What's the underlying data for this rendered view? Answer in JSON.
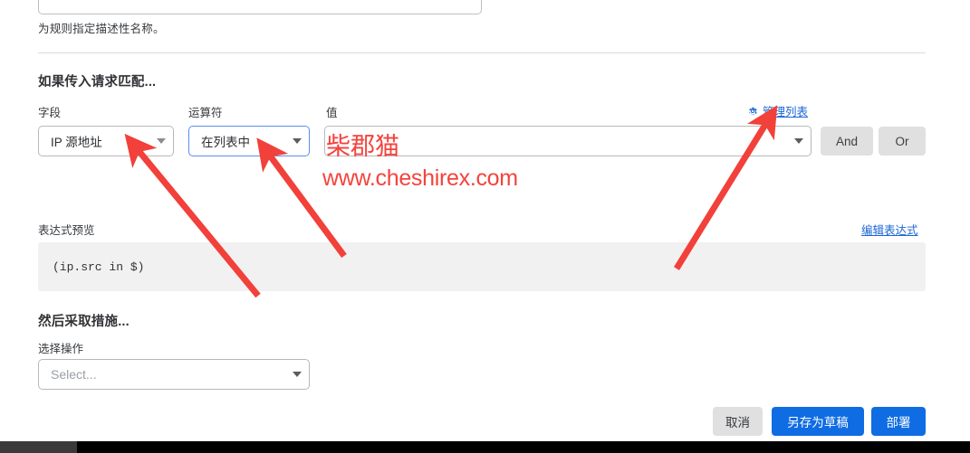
{
  "form": {
    "rule_name_value": "",
    "helper_text": "为规则指定描述性名称。",
    "match_section_heading": "如果传入请求匹配...",
    "action_section_heading": "然后采取措施...",
    "labels": {
      "field": "字段",
      "operator": "运算符",
      "value": "值",
      "select_action": "选择操作",
      "expression_preview": "表达式预览"
    },
    "selects": {
      "field_value": "IP 源地址",
      "operator_value": "在列表中",
      "value_value": "",
      "action_placeholder": "Select..."
    },
    "logic": {
      "and_label": "And",
      "or_label": "Or"
    },
    "links": {
      "manage_list": "管理列表",
      "edit_expression": "编辑表达式"
    },
    "expression": "(ip.src in $)",
    "buttons": {
      "cancel": "取消",
      "save_draft": "另存为草稿",
      "deploy": "部署"
    }
  },
  "watermark": {
    "title": "柴郡猫",
    "url": "www.cheshirex.com",
    "color": "#f4433c"
  },
  "annotations": {
    "arrow_color": "#f2403a",
    "arrow_count": 3
  },
  "colors": {
    "link_blue": "#1a66d6",
    "primary_button": "#0f6ce3",
    "secondary_button": "#e0e0e0",
    "focus_border": "#5b8def",
    "expression_bg": "#f1f1f1"
  }
}
